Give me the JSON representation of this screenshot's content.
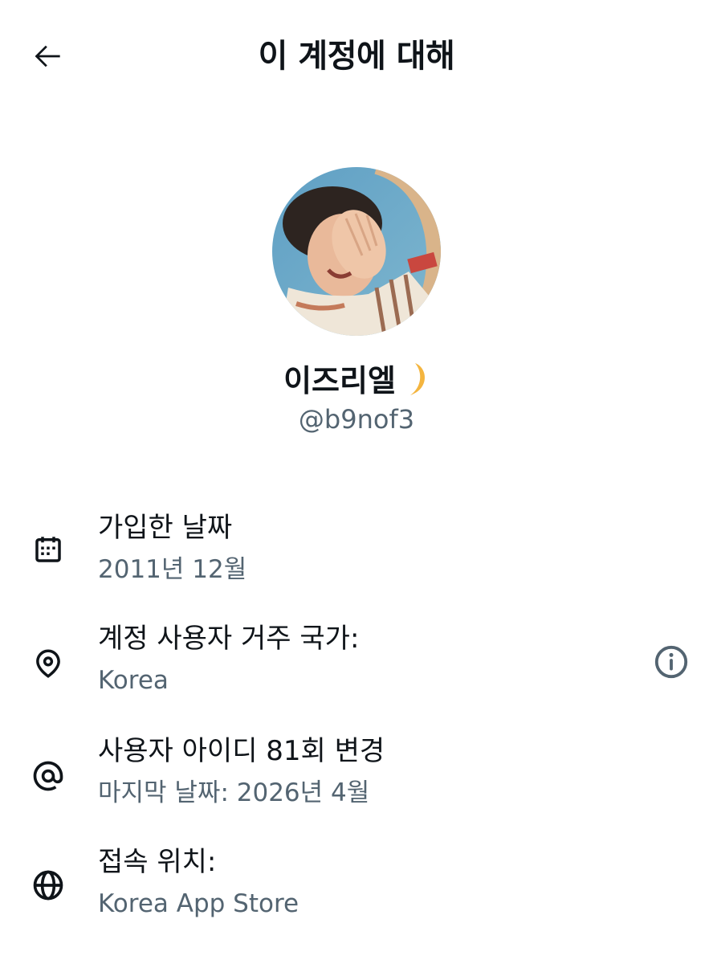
{
  "header": {
    "title": "이 계정에 대해",
    "back_icon": "arrow-left-icon"
  },
  "profile": {
    "display_name": "이즈리엘",
    "name_emoji": "🌙",
    "handle": "@b9nof3"
  },
  "rows": [
    {
      "icon": "calendar-icon",
      "label": "가입한 날짜",
      "value": "2011년 12월"
    },
    {
      "icon": "location-pin-icon",
      "label": "계정 사용자 거주 국가:",
      "value": "Korea",
      "trailing_icon": "info-icon"
    },
    {
      "icon": "at-sign-icon",
      "label": "사용자 아이디 81회 변경",
      "value": "마지막 날짜: 2026년 4월"
    },
    {
      "icon": "globe-icon",
      "label": "접속 위치:",
      "value": "Korea App Store"
    }
  ],
  "colors": {
    "text_primary": "#0f1419",
    "text_secondary": "#536471",
    "background": "#ffffff"
  }
}
